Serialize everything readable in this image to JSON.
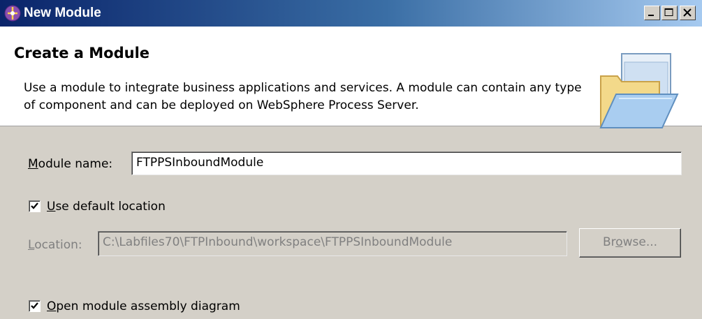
{
  "window": {
    "title": "New Module",
    "app_icon": "module-wizard-icon",
    "controls": [
      "minimize-icon",
      "maximize-icon",
      "close-icon"
    ]
  },
  "header": {
    "title": "Create a Module",
    "description": "Use a module to integrate business applications and services. A module can contain any type of component and can be deployed on WebSphere Process Server.",
    "icon": "open-folder-icon"
  },
  "form": {
    "module_name": {
      "label_mnemonic": "M",
      "label_rest": "odule name:",
      "value": "FTPPSInboundModule"
    },
    "use_default_location": {
      "checked": true,
      "label_mnemonic": "U",
      "label_rest": "se default location"
    },
    "location": {
      "label_mnemonic": "L",
      "label_rest": "ocation:",
      "value": "C:\\Labfiles70\\FTPInbound\\workspace\\FTPPSInboundModule",
      "enabled": false
    },
    "browse": {
      "label_pre": "Br",
      "label_mnemonic": "o",
      "label_post": "wse...",
      "enabled": false
    },
    "open_assembly_diagram": {
      "checked": true,
      "label_mnemonic": "O",
      "label_rest": "pen module assembly diagram"
    }
  },
  "colors": {
    "titlebar_start": "#0a246a",
    "titlebar_end": "#a6caf0",
    "dialog_bg": "#d4d0c8",
    "disabled_text": "#808080"
  }
}
